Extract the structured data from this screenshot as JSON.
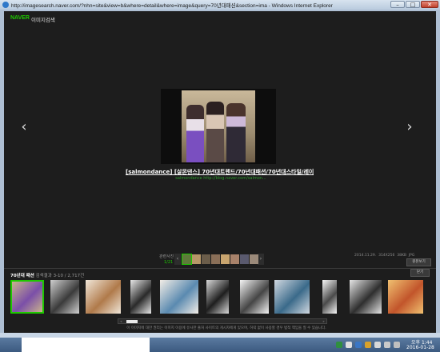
{
  "window": {
    "title": "http://imagesearch.naver.com/?nhn=site&view=b&where=detail&where=image&query=70년대패션&section=ima - Windows Internet Explorer",
    "min_label": "–",
    "max_label": "□",
    "close_label": "✕"
  },
  "header": {
    "brand": "NAVER",
    "section": "이미지검색"
  },
  "viewer": {
    "prev_icon": "‹",
    "next_icon": "›",
    "caption": "[salmondance] [살몬댄스] 70년대트렌드/70년대패션/70년대스타일/레이체...",
    "source": "salmondance   http://blog.naver.com/salmon..."
  },
  "related": {
    "label": "관련사진",
    "count": "1/21",
    "prev": "‹",
    "next": "›",
    "items": [
      {
        "color": "#5e7a3a",
        "selected": true
      },
      {
        "color": "#b79768",
        "selected": false
      },
      {
        "color": "#6b5d4a",
        "selected": false
      },
      {
        "color": "#8a6f58",
        "selected": false
      },
      {
        "color": "#c9a56f",
        "selected": false
      },
      {
        "color": "#a8826a",
        "selected": false
      },
      {
        "color": "#5a5a6e",
        "selected": false
      },
      {
        "color": "#9b8a7a",
        "selected": false
      }
    ]
  },
  "meta": {
    "date": "2014.11.29.",
    "size": "314X256",
    "filesize": "38KB",
    "format": "JPG",
    "original_button": "원본보기"
  },
  "strip": {
    "query": "70년대 패션",
    "results_label": "검색결과",
    "count": "3-10 / 2,717건",
    "close_button": "닫기",
    "thumbs": [
      {
        "color_a": "#7b4fa8",
        "color_b": "#c9b28c",
        "selected": true
      },
      {
        "color_a": "#3a3a3a",
        "color_b": "#cfcfcf",
        "selected": false
      },
      {
        "color_a": "#b07a4a",
        "color_b": "#f0e6d8",
        "selected": false
      },
      {
        "color_a": "#2a2a2a",
        "color_b": "#e8e8e8",
        "selected": false
      },
      {
        "color_a": "#5a8ab0",
        "color_b": "#f2ede6",
        "selected": false
      },
      {
        "color_a": "#1e1e1e",
        "color_b": "#d8d8d8",
        "selected": false
      },
      {
        "color_a": "#444444",
        "color_b": "#f4f4f4",
        "selected": false
      },
      {
        "color_a": "#3a6a8a",
        "color_b": "#d0d8e0",
        "selected": false
      },
      {
        "color_a": "#4a4a4a",
        "color_b": "#f8f8f8",
        "selected": false
      },
      {
        "color_a": "#2e2e2e",
        "color_b": "#e4e4e4",
        "selected": false
      },
      {
        "color_a": "#c2552b",
        "color_b": "#f0c070",
        "selected": false
      }
    ],
    "scroll_left": "«",
    "scroll_right": "»",
    "notice": "이 이미지에 대한 권리는 이미지 이용에 유사한 출처 사이트의 게시자에게 있으며, 허락 없이 사용할 경우 법적 책임을 질 수 있습니다."
  },
  "taskbar": {
    "time": "오후 1:44",
    "date": "2016-01-28"
  }
}
